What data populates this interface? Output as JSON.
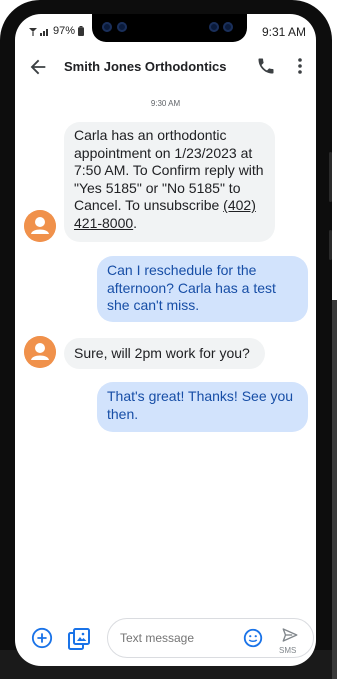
{
  "status": {
    "battery_text": "97%",
    "time": "9:31 AM"
  },
  "header": {
    "contact": "Smith Jones Orthodontics"
  },
  "conversation": {
    "timestamp": "9:30 AM",
    "messages": [
      {
        "dir": "in",
        "text": "Carla has an orthodontic appointment on 1/23/2023 at 7:50 AM. To Confirm reply with \"Yes 5185\" or \"No 5185\" to Cancel. To unsubscribe",
        "link": "(402) 421-8000",
        "suffix": "."
      },
      {
        "dir": "out",
        "text": "Can I reschedule for the afternoon? Carla has a test she can't miss."
      },
      {
        "dir": "in",
        "text": "Sure, will 2pm work for you?"
      },
      {
        "dir": "out",
        "text": "That's great! Thanks! See you then."
      }
    ]
  },
  "composer": {
    "placeholder": "Text message",
    "send_label": "SMS"
  },
  "colors": {
    "outgoing_bg": "#d2e3fc",
    "outgoing_text": "#174ea6",
    "incoming_bg": "#f1f3f4",
    "avatar": "#f0914b",
    "accent": "#1a73e8"
  },
  "icons": [
    "back-arrow-icon",
    "phone-icon",
    "more-vert-icon",
    "avatar-person-icon",
    "add-icon",
    "gallery-icon",
    "emoji-icon",
    "send-icon"
  ]
}
